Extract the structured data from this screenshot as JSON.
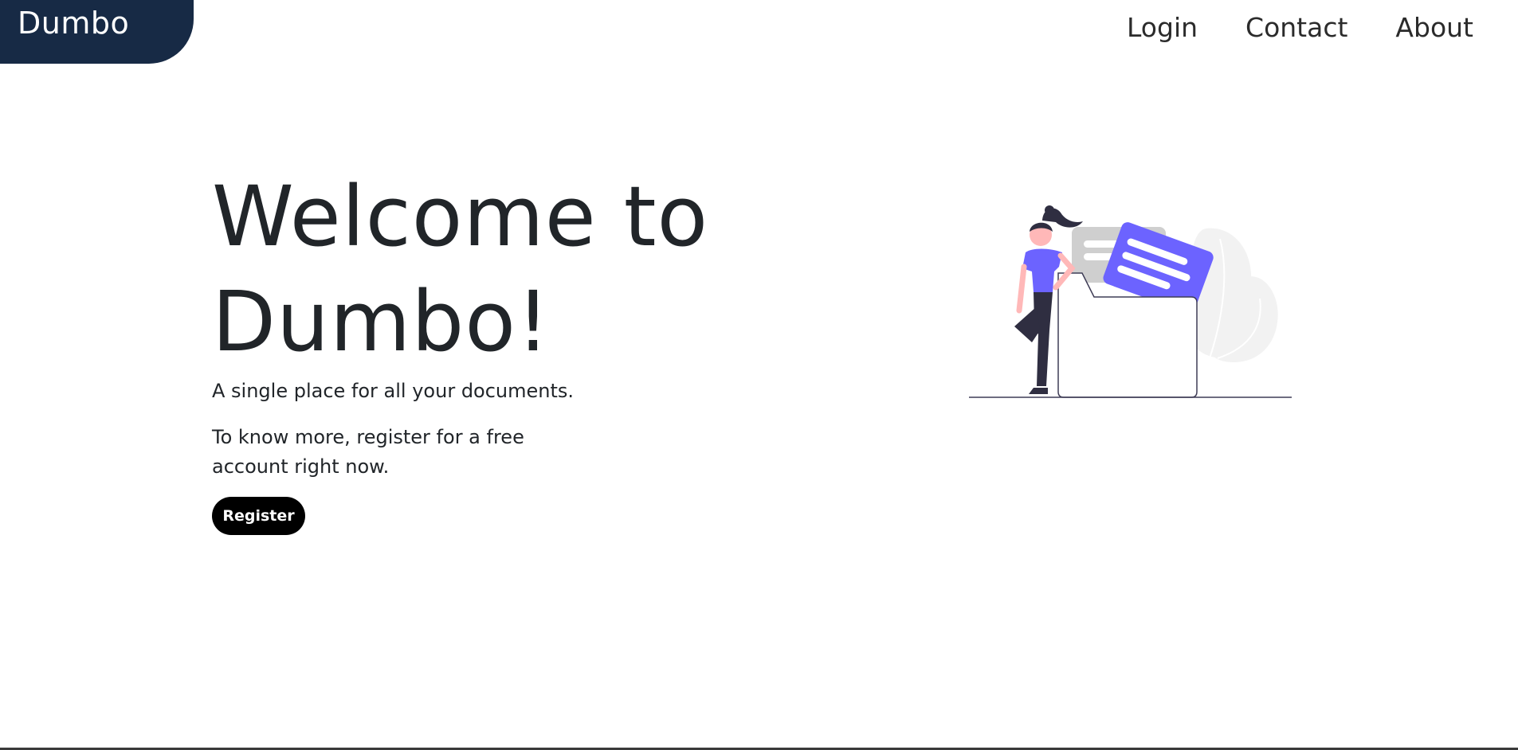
{
  "brand": {
    "name": "Dumbo"
  },
  "nav": {
    "login": "Login",
    "contact": "Contact",
    "about": "About"
  },
  "hero": {
    "title_line1": "Welcome to",
    "title_line2": "Dumbo!",
    "subtitle": "A single place for all your documents.",
    "more": "To know more, register for a free account right now.",
    "register_label": "Register"
  },
  "colors": {
    "brand_bg": "#172a45",
    "accent": "#6c63ff",
    "button_bg": "#000000"
  }
}
